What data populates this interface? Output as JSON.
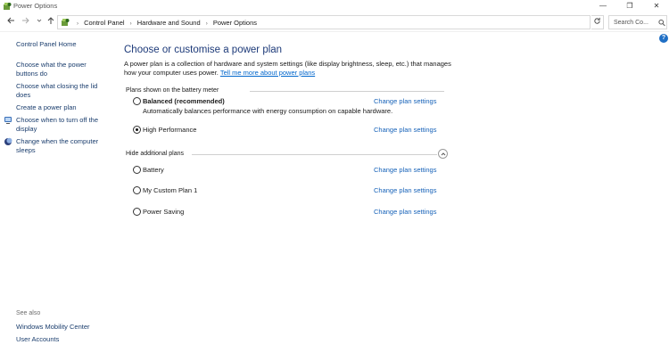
{
  "window": {
    "title": "Power Options",
    "controls": {
      "minimize": "—",
      "maximize": "❐",
      "close": "✕"
    }
  },
  "nav": {
    "back_icon": "arrow-left-icon",
    "forward_icon": "arrow-right-icon",
    "up_icon": "arrow-up-icon",
    "breadcrumbs": [
      "Control Panel",
      "Hardware and Sound",
      "Power Options"
    ],
    "search_placeholder": "Search Co..."
  },
  "sidebar": {
    "home": "Control Panel Home",
    "items": [
      "Choose what the power buttons do",
      "Choose what closing the lid does",
      "Create a power plan",
      "Choose when to turn off the display",
      "Change when the computer sleeps"
    ],
    "see_also_label": "See also",
    "see_also": [
      "Windows Mobility Center",
      "User Accounts"
    ]
  },
  "main": {
    "heading": "Choose or customise a power plan",
    "description": "A power plan is a collection of hardware and system settings (like display brightness, sleep, etc.) that manages how your computer uses power.",
    "description_link": "Tell me more about power plans",
    "battery_group_label": "Plans shown on the battery meter",
    "hide_group_label": "Hide additional plans",
    "change_label": "Change plan settings",
    "plans": [
      {
        "name": "Balanced (recommended)",
        "description": "Automatically balances performance with energy consumption on capable hardware.",
        "selected": false
      },
      {
        "name": "High Performance",
        "description": "",
        "selected": true
      },
      {
        "name": "Battery",
        "description": "",
        "selected": false
      },
      {
        "name": "My Custom Plan 1",
        "description": "",
        "selected": false
      },
      {
        "name": "Power Saving",
        "description": "",
        "selected": false
      }
    ]
  },
  "colors": {
    "heading": "#1d3a79",
    "link": "#1561b8",
    "sidebar_link": "#1a3d6d",
    "help": "#1f6fc5"
  }
}
